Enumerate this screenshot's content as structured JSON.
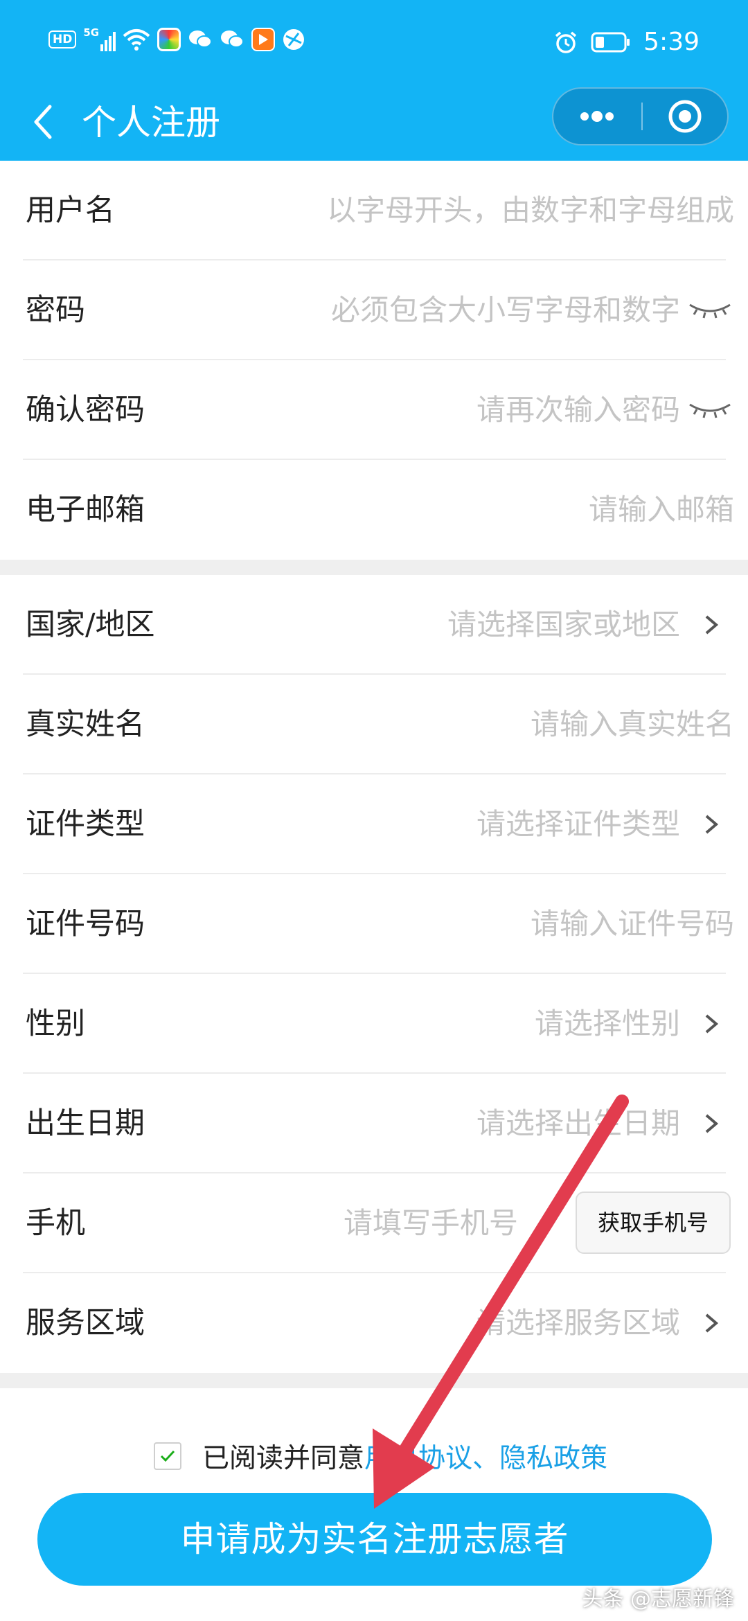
{
  "status_bar": {
    "hd": "HD",
    "network": "5G",
    "time": "5:39"
  },
  "nav": {
    "title": "个人注册"
  },
  "account_section": [
    {
      "label": "用户名",
      "placeholder": "以字母开头，由数字和字母组成"
    },
    {
      "label": "密码",
      "placeholder": "必须包含大小写字母和数字"
    },
    {
      "label": "确认密码",
      "placeholder": "请再次输入密码"
    },
    {
      "label": "电子邮箱",
      "placeholder": "请输入邮箱"
    }
  ],
  "profile_section": [
    {
      "label": "国家/地区",
      "placeholder": "请选择国家或地区"
    },
    {
      "label": "真实姓名",
      "placeholder": "请输入真实姓名"
    },
    {
      "label": "证件类型",
      "placeholder": "请选择证件类型"
    },
    {
      "label": "证件号码",
      "placeholder": "请输入证件号码"
    },
    {
      "label": "性别",
      "placeholder": "请选择性别"
    },
    {
      "label": "出生日期",
      "placeholder": "请选择出生日期"
    },
    {
      "label": "手机",
      "placeholder": "请填写手机号",
      "button": "获取手机号"
    },
    {
      "label": "服务区域",
      "placeholder": "请选择服务区域"
    }
  ],
  "agreement": {
    "prefix": "已阅读并同意",
    "user_agreement": "用户协议",
    "separator": "、",
    "privacy_policy": "隐私政策"
  },
  "submit_label": "申请成为实名注册志愿者",
  "watermark": "头条 @志愿新锋",
  "colors": {
    "primary": "#13b4f5",
    "link": "#1aa0e6",
    "arrow": "#e23c4e"
  },
  "icons": [
    "back-arrow-icon",
    "more-dots-icon",
    "close-target-icon",
    "eye-closed-icon",
    "chevron-right-icon",
    "checkmark-icon"
  ]
}
